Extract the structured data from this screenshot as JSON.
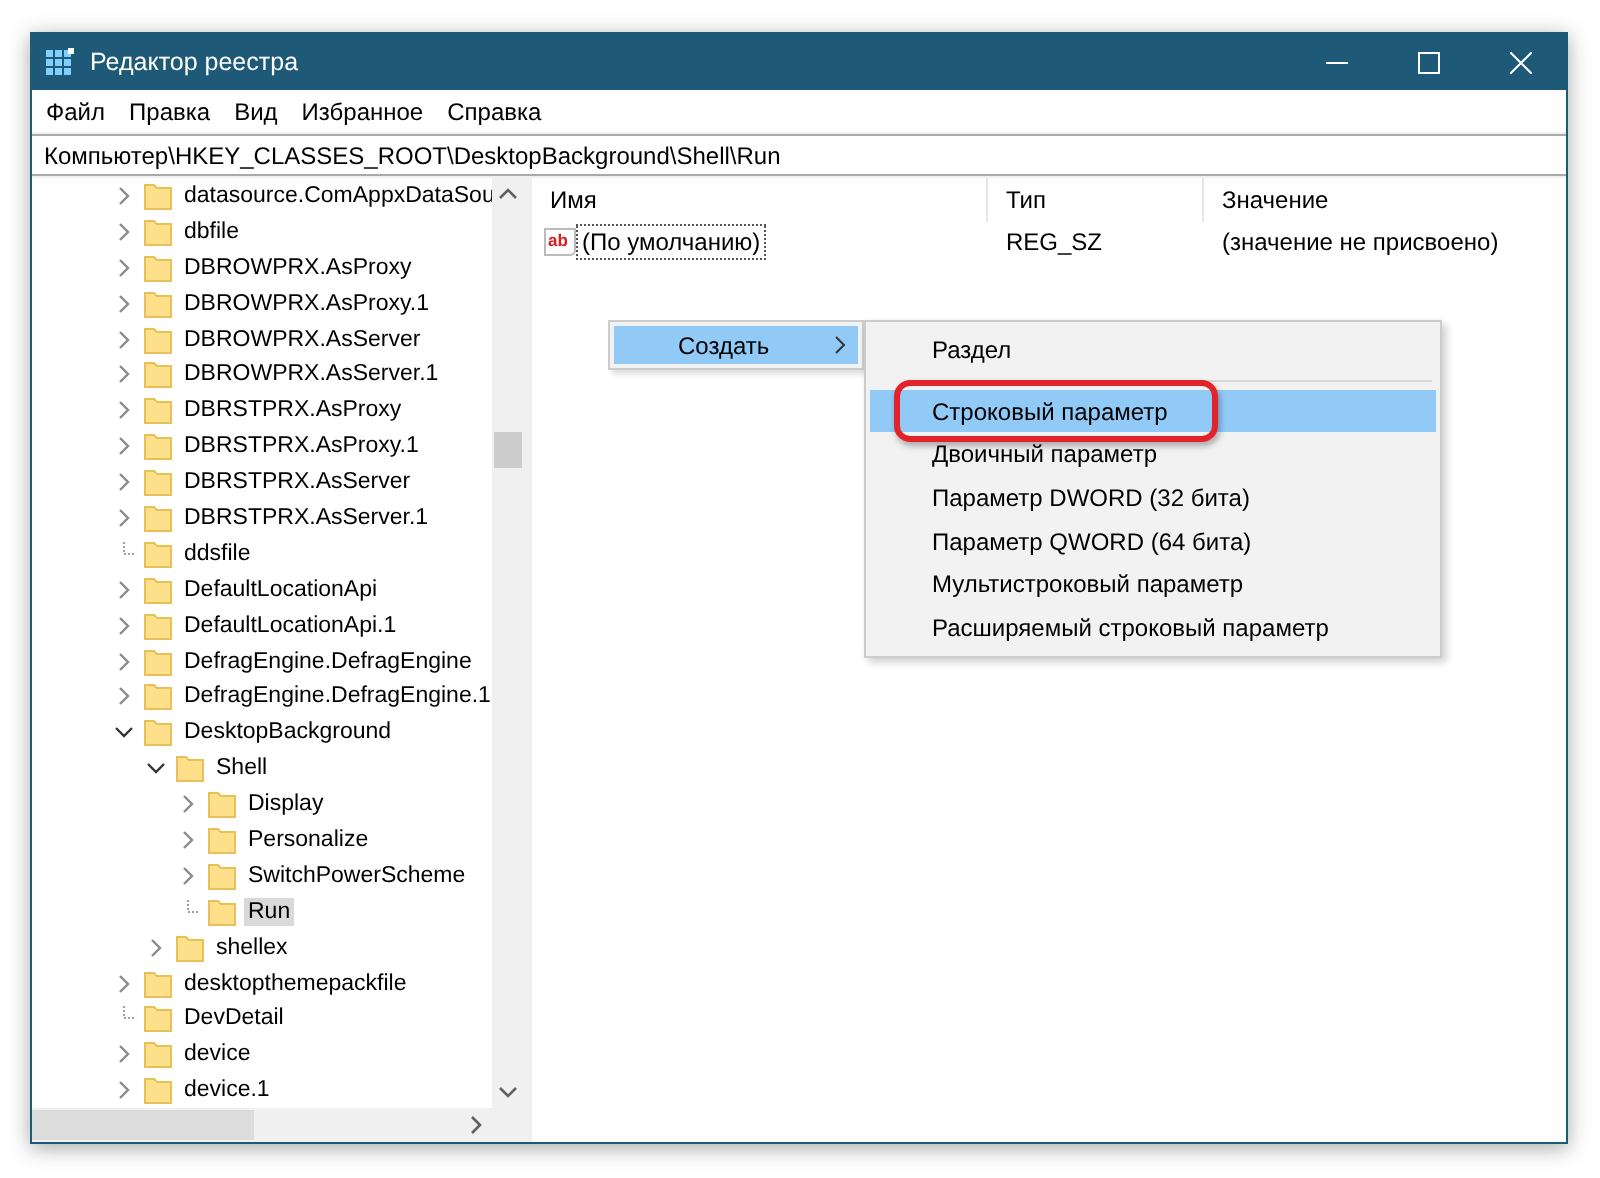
{
  "window": {
    "title": "Редактор реестра"
  },
  "menu": [
    "Файл",
    "Правка",
    "Вид",
    "Избранное",
    "Справка"
  ],
  "address": "Компьютер\\HKEY_CLASSES_ROOT\\DesktopBackground\\Shell\\Run",
  "tree": [
    {
      "label": "datasource.ComAppxDataSou",
      "kind": "collapsed",
      "selected": false
    },
    {
      "label": "dbfile",
      "kind": "collapsed",
      "selected": false
    },
    {
      "label": "DBROWPRX.AsProxy",
      "kind": "collapsed",
      "selected": false
    },
    {
      "label": "DBROWPRX.AsProxy.1",
      "kind": "collapsed",
      "selected": false
    },
    {
      "label": "DBROWPRX.AsServer",
      "kind": "collapsed",
      "selected": false
    },
    {
      "label": "DBROWPRX.AsServer.1",
      "kind": "collapsed",
      "selected": false
    },
    {
      "label": "DBRSTPRX.AsProxy",
      "kind": "collapsed",
      "selected": false
    },
    {
      "label": "DBRSTPRX.AsProxy.1",
      "kind": "collapsed",
      "selected": false
    },
    {
      "label": "DBRSTPRX.AsServer",
      "kind": "collapsed",
      "selected": false
    },
    {
      "label": "DBRSTPRX.AsServer.1",
      "kind": "collapsed",
      "selected": false
    },
    {
      "label": "ddsfile",
      "kind": "leaf",
      "selected": false
    },
    {
      "label": "DefaultLocationApi",
      "kind": "collapsed",
      "selected": false
    },
    {
      "label": "DefaultLocationApi.1",
      "kind": "collapsed",
      "selected": false
    },
    {
      "label": "DefragEngine.DefragEngine",
      "kind": "collapsed",
      "selected": false
    },
    {
      "label": "DefragEngine.DefragEngine.1",
      "kind": "collapsed",
      "selected": false
    },
    {
      "label": "DesktopBackground",
      "kind": "expanded",
      "selected": false,
      "children": [
        {
          "label": "Shell",
          "kind": "expanded",
          "selected": false,
          "children": [
            {
              "label": "Display",
              "kind": "collapsed",
              "selected": false
            },
            {
              "label": "Personalize",
              "kind": "collapsed",
              "selected": false
            },
            {
              "label": "SwitchPowerScheme",
              "kind": "collapsed",
              "selected": false
            },
            {
              "label": "Run",
              "kind": "leaf",
              "selected": true
            }
          ]
        },
        {
          "label": "shellex",
          "kind": "collapsed",
          "selected": false
        }
      ]
    },
    {
      "label": "desktopthemepackfile",
      "kind": "collapsed",
      "selected": false
    },
    {
      "label": "DevDetail",
      "kind": "leaf",
      "selected": false
    },
    {
      "label": "device",
      "kind": "collapsed",
      "selected": false
    },
    {
      "label": "device.1",
      "kind": "collapsed",
      "selected": false
    }
  ],
  "values": {
    "columns": [
      "Имя",
      "Тип",
      "Значение"
    ],
    "rows": [
      {
        "icon": "ab",
        "name": "(По умолчанию)",
        "type": "REG_SZ",
        "value": "(значение не присвоено)",
        "focused": true
      }
    ]
  },
  "context_menu": {
    "items": [
      {
        "label": "Создать",
        "selected": true
      }
    ]
  },
  "submenu": {
    "items": [
      {
        "kind": "item",
        "label": "Раздел",
        "selected": false,
        "annotated": false
      },
      {
        "kind": "separator"
      },
      {
        "kind": "item",
        "label": "Строковый параметр",
        "selected": true,
        "annotated": true
      },
      {
        "kind": "item",
        "label": "Двоичный параметр",
        "selected": false,
        "annotated": false
      },
      {
        "kind": "item",
        "label": "Параметр DWORD (32 бита)",
        "selected": false,
        "annotated": false
      },
      {
        "kind": "item",
        "label": "Параметр QWORD (64 бита)",
        "selected": false,
        "annotated": false
      },
      {
        "kind": "item",
        "label": "Мультистроковый параметр",
        "selected": false,
        "annotated": false
      },
      {
        "kind": "item",
        "label": "Расширяемый строковый параметр",
        "selected": false,
        "annotated": false
      }
    ]
  }
}
